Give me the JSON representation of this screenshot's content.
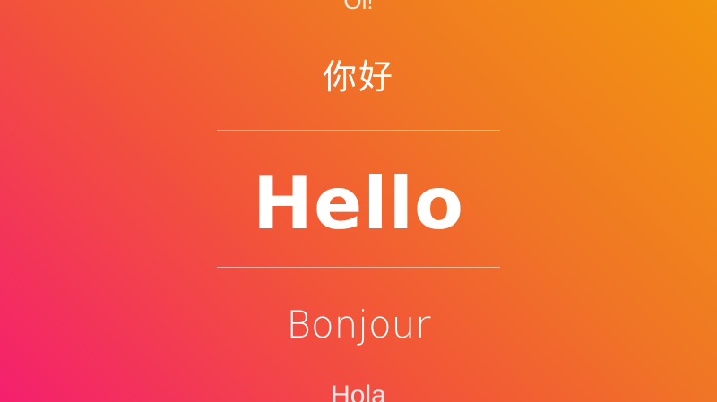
{
  "greeting_picker": {
    "items": [
      {
        "text": "Oi!",
        "state": "above"
      },
      {
        "text": "你好",
        "state": "above"
      },
      {
        "text": "Hello",
        "state": "selected"
      },
      {
        "text": "Bonjour",
        "state": "below"
      },
      {
        "text": "Hola",
        "state": "below"
      }
    ],
    "selected_index": 2
  },
  "colors": {
    "gradient_top_right": "#f2960e",
    "gradient_bottom_left": "#f41f6e",
    "text": "#ffffff",
    "divider": "rgba(255,255,255,0.55)"
  }
}
